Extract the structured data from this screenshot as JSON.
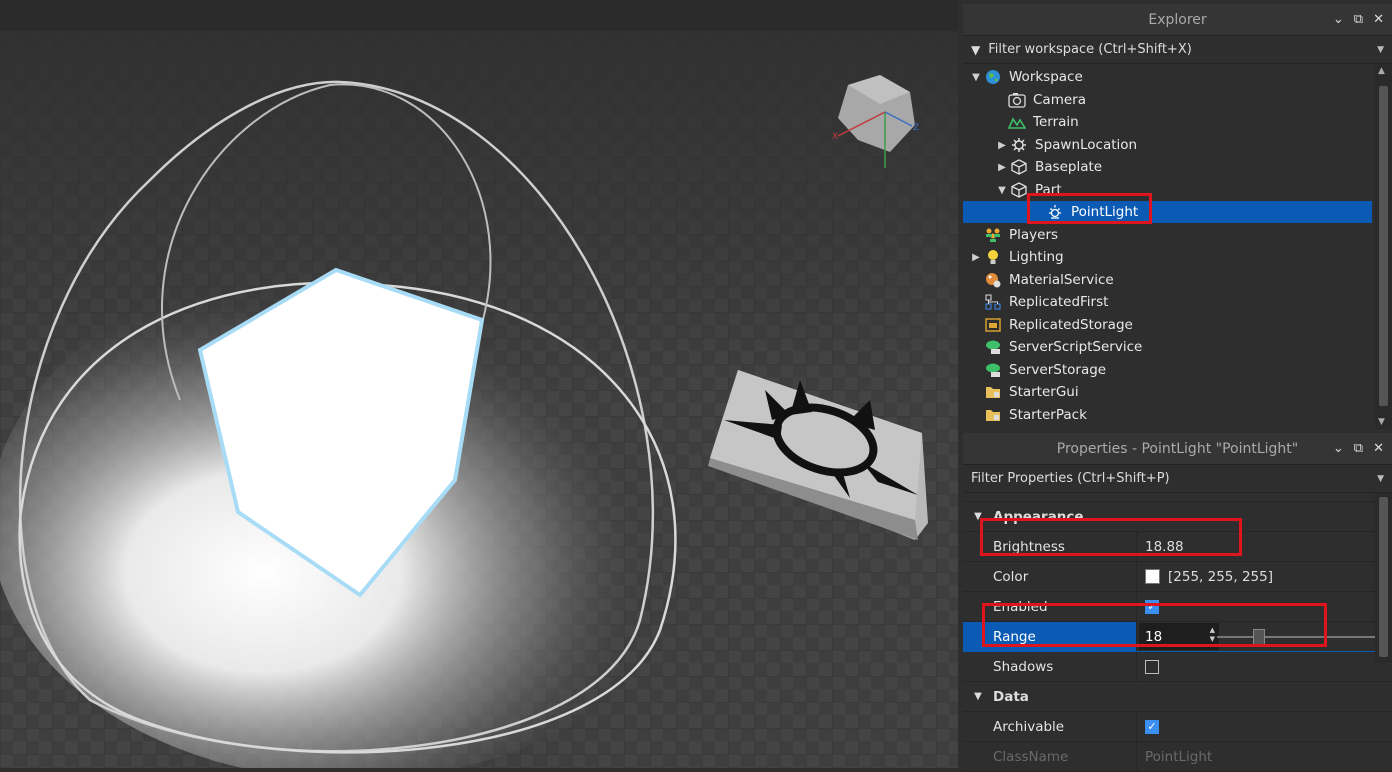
{
  "explorer": {
    "title": "Explorer",
    "filter_placeholder": "Filter workspace (Ctrl+Shift+X)",
    "items": [
      {
        "label": "Workspace",
        "icon": "workspace-globe-icon"
      },
      {
        "label": "Camera",
        "icon": "camera-icon"
      },
      {
        "label": "Terrain",
        "icon": "terrain-icon"
      },
      {
        "label": "SpawnLocation",
        "icon": "spawn-gear-icon"
      },
      {
        "label": "Baseplate",
        "icon": "part-cube-icon"
      },
      {
        "label": "Part",
        "icon": "part-cube-icon"
      },
      {
        "label": "PointLight",
        "icon": "pointlight-icon"
      },
      {
        "label": "Players",
        "icon": "players-icon"
      },
      {
        "label": "Lighting",
        "icon": "lightbulb-icon"
      },
      {
        "label": "MaterialService",
        "icon": "material-service-icon"
      },
      {
        "label": "ReplicatedFirst",
        "icon": "replicated-first-icon"
      },
      {
        "label": "ReplicatedStorage",
        "icon": "replicated-storage-icon"
      },
      {
        "label": "ServerScriptService",
        "icon": "server-script-service-icon"
      },
      {
        "label": "ServerStorage",
        "icon": "server-storage-icon"
      },
      {
        "label": "StarterGui",
        "icon": "starter-gui-folder-icon"
      },
      {
        "label": "StarterPack",
        "icon": "starter-pack-folder-icon"
      }
    ]
  },
  "properties": {
    "title": "Properties - PointLight \"PointLight\"",
    "filter_placeholder": "Filter Properties (Ctrl+Shift+P)",
    "sections": {
      "appearance": "Appearance",
      "data": "Data"
    },
    "rows": {
      "brightness": {
        "name": "Brightness",
        "value": "18.88"
      },
      "color": {
        "name": "Color",
        "value": "[255, 255, 255]"
      },
      "enabled": {
        "name": "Enabled",
        "checked": true
      },
      "range": {
        "name": "Range",
        "value": "18",
        "slider_fraction": 0.3
      },
      "shadows": {
        "name": "Shadows",
        "checked": false
      },
      "archivable": {
        "name": "Archivable",
        "checked": true
      },
      "classname": {
        "name": "ClassName",
        "value": "PointLight"
      }
    }
  },
  "colors": {
    "selection": "#0b5bb5",
    "highlight_box": "#e0141d",
    "checkbox_checked": "#3b8ff0"
  }
}
